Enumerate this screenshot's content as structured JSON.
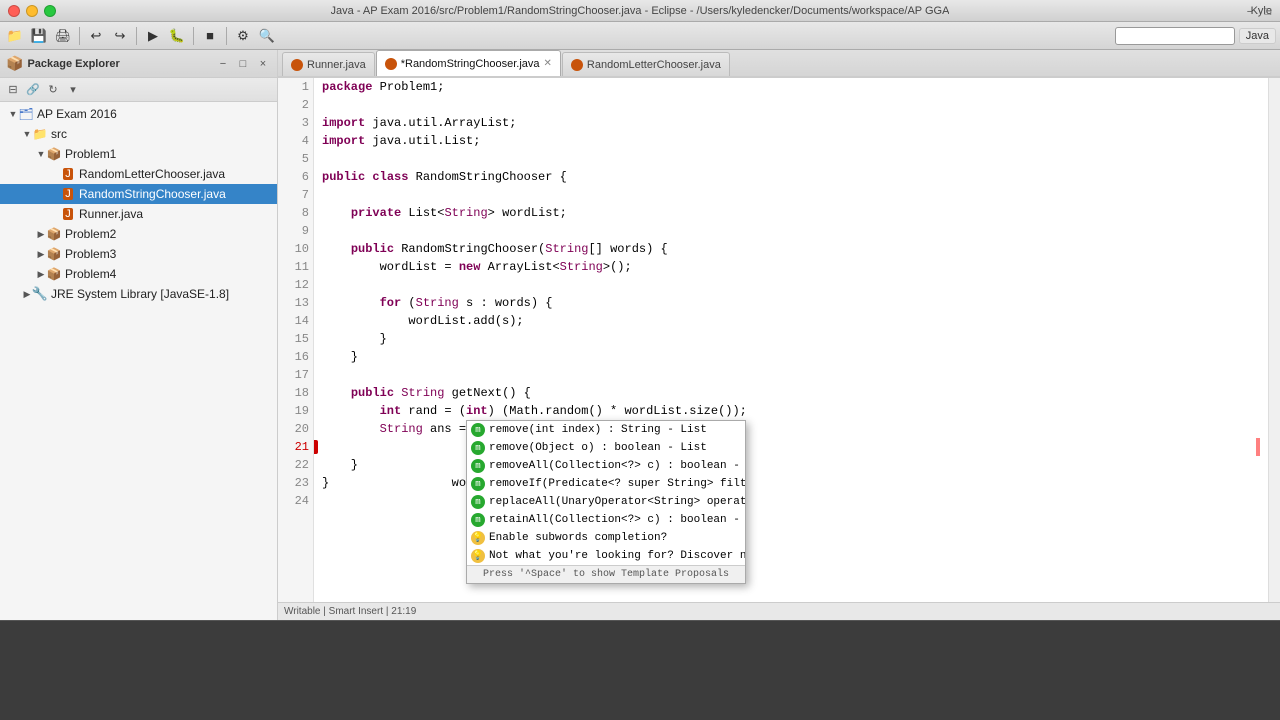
{
  "titlebar": {
    "title": "Java - AP Exam 2016/src/Problem1/RandomStringChooser.java - Eclipse - /Users/kyledencker/Documents/workspace/AP GGA",
    "user": "Kyle"
  },
  "toolbar": {
    "search_placeholder": "",
    "java_label": "Java"
  },
  "package_explorer": {
    "title": "Package Explorer",
    "tree": [
      {
        "id": "ap2016",
        "label": "AP Exam 2016",
        "level": 0,
        "expanded": true,
        "type": "project"
      },
      {
        "id": "src",
        "label": "src",
        "level": 1,
        "expanded": true,
        "type": "package-root"
      },
      {
        "id": "problem1",
        "label": "Problem1",
        "level": 2,
        "expanded": true,
        "type": "package"
      },
      {
        "id": "randletter",
        "label": "RandomLetterChooser.java",
        "level": 3,
        "expanded": false,
        "type": "java"
      },
      {
        "id": "randstring",
        "label": "RandomStringChooser.java",
        "level": 3,
        "expanded": false,
        "type": "java",
        "selected": true
      },
      {
        "id": "runner",
        "label": "Runner.java",
        "level": 3,
        "expanded": false,
        "type": "java"
      },
      {
        "id": "problem2",
        "label": "Problem2",
        "level": 2,
        "expanded": false,
        "type": "package"
      },
      {
        "id": "problem3",
        "label": "Problem3",
        "level": 2,
        "expanded": false,
        "type": "package"
      },
      {
        "id": "problem4",
        "label": "Problem4",
        "level": 2,
        "expanded": false,
        "type": "package"
      },
      {
        "id": "jre",
        "label": "JRE System Library [JavaSE-1.8]",
        "level": 1,
        "expanded": false,
        "type": "library"
      }
    ]
  },
  "tabs": [
    {
      "id": "runner",
      "label": "Runner.java",
      "active": false
    },
    {
      "id": "randstring",
      "label": "RandomStringChooser.java",
      "active": true,
      "dirty": false
    },
    {
      "id": "randletter",
      "label": "RandomLetterChooser.java",
      "active": false
    }
  ],
  "code": {
    "lines": [
      {
        "num": 1,
        "content": "package Problem1;",
        "tokens": [
          {
            "t": "kw",
            "v": "package"
          },
          {
            "t": "normal",
            "v": " Problem1;"
          }
        ]
      },
      {
        "num": 2,
        "content": "",
        "tokens": []
      },
      {
        "num": 3,
        "content": "import java.util.ArrayList;",
        "tokens": [
          {
            "t": "kw",
            "v": "import"
          },
          {
            "t": "normal",
            "v": " java.util.ArrayList;"
          }
        ]
      },
      {
        "num": 4,
        "content": "import java.util.List;",
        "tokens": [
          {
            "t": "kw",
            "v": "import"
          },
          {
            "t": "normal",
            "v": " java.util.List;"
          }
        ]
      },
      {
        "num": 5,
        "content": "",
        "tokens": []
      },
      {
        "num": 6,
        "content": "public class RandomStringChooser {",
        "tokens": [
          {
            "t": "kw",
            "v": "public"
          },
          {
            "t": "normal",
            "v": " "
          },
          {
            "t": "kw",
            "v": "class"
          },
          {
            "t": "normal",
            "v": " RandomStringChooser {"
          }
        ]
      },
      {
        "num": 7,
        "content": "",
        "tokens": []
      },
      {
        "num": 8,
        "content": "    private List<String> wordList;",
        "tokens": [
          {
            "t": "normal",
            "v": "    "
          },
          {
            "t": "kw",
            "v": "private"
          },
          {
            "t": "normal",
            "v": " List<String> wordList;"
          }
        ]
      },
      {
        "num": 9,
        "content": "",
        "tokens": []
      },
      {
        "num": 10,
        "content": "    public RandomStringChooser(String[] words) {",
        "tokens": [
          {
            "t": "normal",
            "v": "    "
          },
          {
            "t": "kw",
            "v": "public"
          },
          {
            "t": "normal",
            "v": " RandomStringChooser("
          },
          {
            "t": "type",
            "v": "String"
          },
          {
            "t": "normal",
            "v": "[] words) {"
          }
        ]
      },
      {
        "num": 11,
        "content": "        wordList = new ArrayList<String>();",
        "tokens": [
          {
            "t": "normal",
            "v": "        wordList = "
          },
          {
            "t": "kw",
            "v": "new"
          },
          {
            "t": "normal",
            "v": " ArrayList<"
          },
          {
            "t": "type",
            "v": "String"
          },
          {
            "t": "normal",
            "v": ">();"
          }
        ]
      },
      {
        "num": 12,
        "content": "",
        "tokens": []
      },
      {
        "num": 13,
        "content": "        for (String s : words) {",
        "tokens": [
          {
            "t": "normal",
            "v": "        "
          },
          {
            "t": "kw",
            "v": "for"
          },
          {
            "t": "normal",
            "v": " ("
          },
          {
            "t": "type",
            "v": "String"
          },
          {
            "t": "normal",
            "v": " s : words) {"
          }
        ]
      },
      {
        "num": 14,
        "content": "            wordList.add(s);",
        "tokens": [
          {
            "t": "normal",
            "v": "            wordList.add(s);"
          }
        ]
      },
      {
        "num": 15,
        "content": "        }",
        "tokens": [
          {
            "t": "normal",
            "v": "        }"
          }
        ]
      },
      {
        "num": 16,
        "content": "    }",
        "tokens": [
          {
            "t": "normal",
            "v": "    }"
          }
        ]
      },
      {
        "num": 17,
        "content": "",
        "tokens": []
      },
      {
        "num": 18,
        "content": "    public String getNext() {",
        "tokens": [
          {
            "t": "normal",
            "v": "    "
          },
          {
            "t": "kw",
            "v": "public"
          },
          {
            "t": "normal",
            "v": " "
          },
          {
            "t": "type",
            "v": "String"
          },
          {
            "t": "normal",
            "v": " getNext() {"
          }
        ]
      },
      {
        "num": 19,
        "content": "        int rand = (int) (Math.random() * wordList.size());",
        "tokens": [
          {
            "t": "normal",
            "v": "        "
          },
          {
            "t": "kw",
            "v": "int"
          },
          {
            "t": "normal",
            "v": " rand = ("
          },
          {
            "t": "kw",
            "v": "int"
          },
          {
            "t": "normal",
            "v": ") (Math.random() * wordList.size());"
          }
        ]
      },
      {
        "num": 20,
        "content": "        String ans = wordList.get(rand);",
        "tokens": [
          {
            "t": "normal",
            "v": "        "
          },
          {
            "t": "type",
            "v": "String"
          },
          {
            "t": "normal",
            "v": " ans = wordList.get(rand);"
          }
        ]
      },
      {
        "num": 21,
        "content": "        wordList.r",
        "tokens": [
          {
            "t": "normal",
            "v": "        wordList.r"
          }
        ],
        "error": true
      },
      {
        "num": 22,
        "content": "    }",
        "tokens": [
          {
            "t": "normal",
            "v": "    }"
          }
        ]
      },
      {
        "num": 23,
        "content": "}",
        "tokens": [
          {
            "t": "normal",
            "v": "}"
          }
        ]
      },
      {
        "num": 24,
        "content": "",
        "tokens": []
      }
    ]
  },
  "autocomplete": {
    "items": [
      {
        "id": "remove-int",
        "label": "remove(int index) : String - List",
        "type": "method"
      },
      {
        "id": "remove-obj",
        "label": "remove(Object o) : boolean - List",
        "type": "method"
      },
      {
        "id": "removeAll",
        "label": "removeAll(Collection<?> c) : boolean - List",
        "type": "method"
      },
      {
        "id": "removeIf",
        "label": "removeIf(Predicate<? super String> filter) : bool",
        "type": "method"
      },
      {
        "id": "replaceAll",
        "label": "replaceAll(UnaryOperator<String> operator) : vo",
        "type": "method"
      },
      {
        "id": "retainAll",
        "label": "retainAll(Collection<?> c) : boolean - List",
        "type": "method"
      },
      {
        "id": "enable-subwords",
        "label": "Enable subwords completion?",
        "type": "info"
      },
      {
        "id": "discover-ext",
        "label": "Not what you're looking for? Discover new exte",
        "type": "info"
      }
    ],
    "footer": "Press '^Space' to show Template Proposals"
  }
}
